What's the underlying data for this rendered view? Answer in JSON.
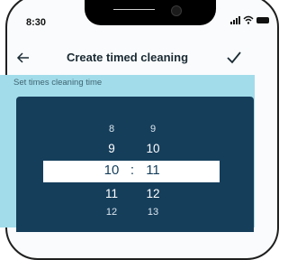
{
  "status_bar": {
    "time": "8:30",
    "icons": [
      "signal-icon",
      "wifi-icon",
      "battery-icon"
    ]
  },
  "header": {
    "back_icon": "arrow-left-icon",
    "title": "Create timed cleaning",
    "confirm_icon": "checkmark-icon"
  },
  "subtitle": "Set times cleaning time",
  "time_picker": {
    "hours": [
      "8",
      "9",
      "10",
      "11",
      "12"
    ],
    "minutes": [
      "9",
      "10",
      "11",
      "12",
      "13"
    ],
    "selected_hour": "10",
    "selected_minute": "11",
    "separator": ":"
  },
  "colors": {
    "accent_bar": "#a2dcea",
    "picker_bg": "#153e5b",
    "title_text": "#1a2a33"
  }
}
